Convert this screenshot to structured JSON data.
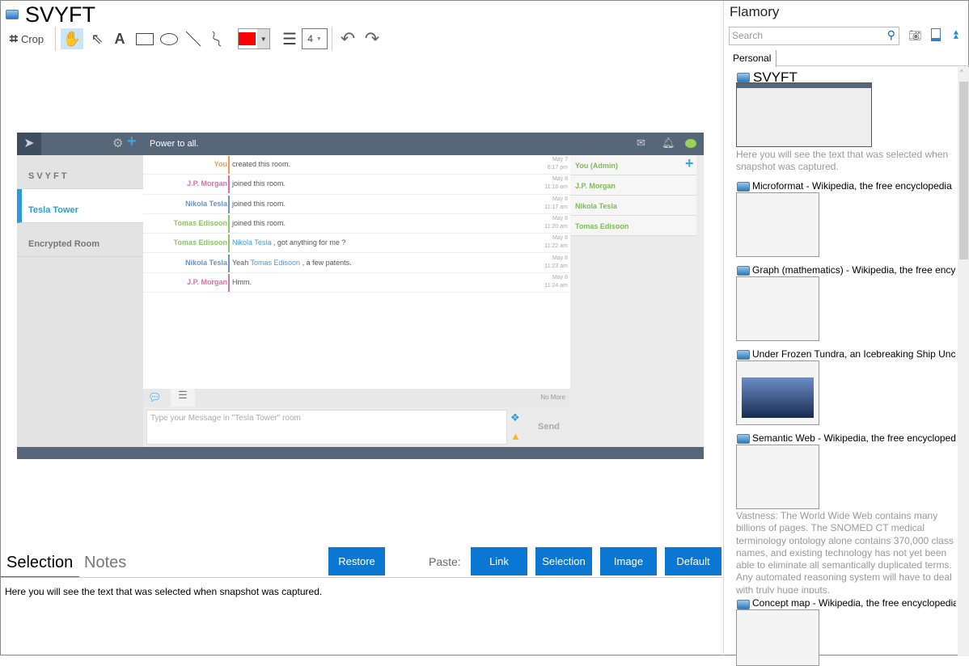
{
  "window": {
    "title": "SVYFT"
  },
  "toolbar": {
    "crop_label": "Crop",
    "line_width": "4",
    "color": "#ff0000"
  },
  "snapshot": {
    "header": "Power to all.",
    "rooms": [
      {
        "label": "SVYFT"
      },
      {
        "label": "Tesla Tower"
      },
      {
        "label": "Encrypted Room"
      }
    ],
    "messages": [
      {
        "name": "You",
        "color": "#e89a55",
        "text": "created this room.",
        "date": "May 7",
        "time": "6:17 pm"
      },
      {
        "name": "J.P. Morgan",
        "color": "#d870a8",
        "text": "joined this room.",
        "date": "May 8",
        "time": "11:16 am"
      },
      {
        "name": "Nikola Tesla",
        "color": "#6b93c8",
        "text": "joined this room.",
        "date": "May 8",
        "time": "11:17 am"
      },
      {
        "name": "Tomas Edisoon",
        "color": "#8cc46a",
        "text": "joined this room.",
        "date": "May 8",
        "time": "11:20 am"
      },
      {
        "name": "Tomas Edisoon",
        "color": "#8cc46a",
        "mention": "Nikola Tesla",
        "text": " , got anything for me ?",
        "date": "May 8",
        "time": "11:22 am"
      },
      {
        "name": "Nikola Tesla",
        "color": "#6b93c8",
        "pre": "Yeah ",
        "mention": "Tomas Edisoon",
        "text": " , a few patents.",
        "date": "May 8",
        "time": "11:23 am"
      },
      {
        "name": "J.P. Morgan",
        "color": "#d870a8",
        "text": "Hmm.",
        "date": "May 8",
        "time": "11:24 am"
      }
    ],
    "members": [
      {
        "label": "You (Admin)"
      },
      {
        "label": "J.P. Morgan"
      },
      {
        "label": "Nikola Tesla"
      },
      {
        "label": "Tomas Edisoon"
      }
    ],
    "no_more": "No More",
    "input_placeholder": "Type your Message in \"Tesla Tower\" room",
    "send": "Send"
  },
  "bottom": {
    "tabs": [
      "Selection",
      "Notes"
    ],
    "restore": "Restore",
    "paste_label": "Paste:",
    "paste_buttons": [
      "Link",
      "Selection",
      "Image",
      "Default"
    ],
    "selection_text": "Here you will see the text that was selected when snapshot was captured."
  },
  "flamory": {
    "title": "Flamory",
    "search_placeholder": "Search",
    "tab": "Personal",
    "items": [
      {
        "title": "SVYFT",
        "desc": "Here you will see the text that was selected when snapshot was captured."
      },
      {
        "title": "Microformat - Wikipedia, the free encyclopedia"
      },
      {
        "title": "Graph (mathematics) - Wikipedia, the free encyclopedia"
      },
      {
        "title": "Under Frozen Tundra, an Icebreaking Ship Uncovers"
      },
      {
        "title": "Semantic Web - Wikipedia, the free encyclopedia",
        "desc": "Vastness: The World Wide Web contains many billions of pages. The SNOMED CT medical terminology ontology alone contains 370,000 class names, and existing technology has not yet been able to eliminate all semantically duplicated terms. Any automated reasoning system will have to deal with truly huge inputs."
      },
      {
        "title": "Concept map - Wikipedia, the free encyclopedia"
      }
    ]
  }
}
